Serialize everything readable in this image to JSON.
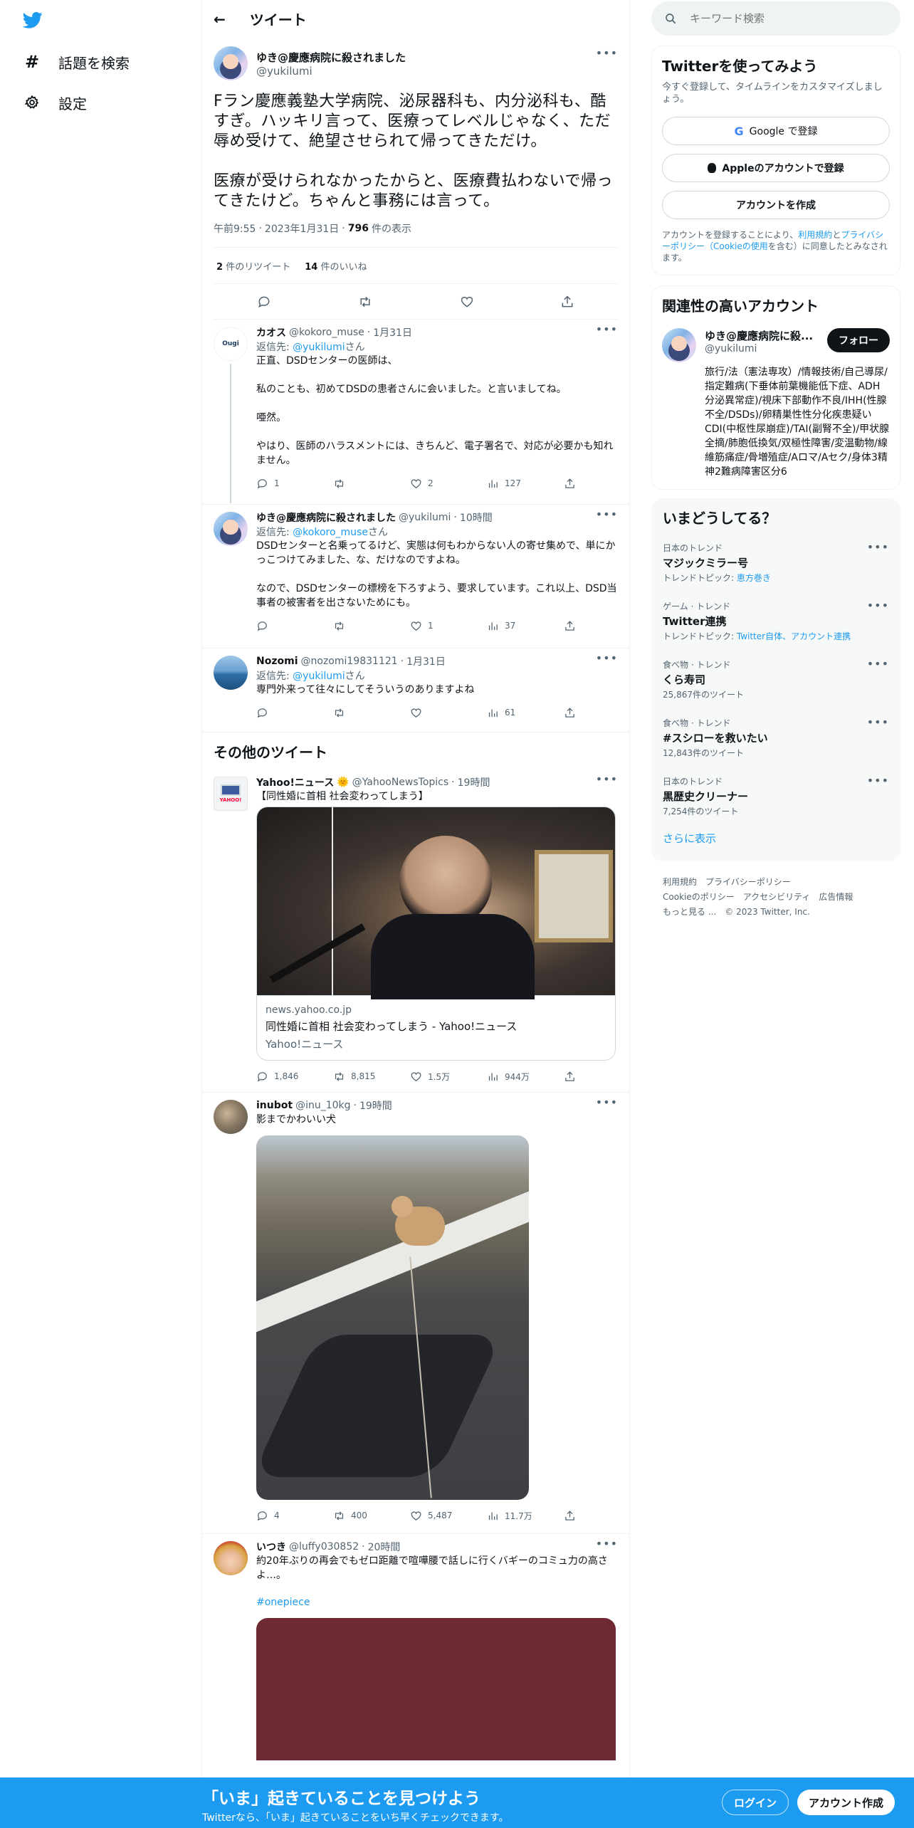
{
  "nav": {
    "explore": "話題を検索",
    "settings": "設定"
  },
  "header": {
    "title": "ツイート"
  },
  "tweet": {
    "author_name": "ゆき@慶應病院に殺されました",
    "author_handle": "@yukilumi",
    "text": "Fラン慶應義塾大学病院、泌尿器科も、内分泌科も、酷すぎ。ハッキリ言って、医療ってレベルじゃなく、ただ辱め受けて、絶望させられて帰ってきただけ。\n\n医療が受けられなかったからと、医療費払わないで帰ってきたけど。ちゃんと事務には言って。",
    "time": "午前9:55",
    "date": "2023年1月31日",
    "views": "796",
    "views_label": "件の表示",
    "retweets": "2",
    "retweets_label": "件のリツイート",
    "likes": "14",
    "likes_label": "件のいいね"
  },
  "replies": [
    {
      "name": "カオス",
      "handle": "@kokoro_muse",
      "time": "1月31日",
      "reply_to_prefix": "返信先: ",
      "reply_to": "@yukilumi",
      "reply_to_suffix": "さん",
      "text": "正直、DSDセンターの医師は、\n\n私のことも、初めてDSDの患者さんに会いました。と言いましてね。\n\n唖然。\n\nやはり、医師のハラスメントには、きちんど、電子署名で、対応が必要かも知れません。",
      "replies": "1",
      "retweets": "",
      "likes": "2",
      "views": "127",
      "avatar_text": "Ougi"
    },
    {
      "name": "ゆき@慶應病院に殺されました",
      "handle": "@yukilumi",
      "time": "10時間",
      "reply_to_prefix": "返信先: ",
      "reply_to": "@kokoro_muse",
      "reply_to_suffix": "さん",
      "text": "DSDセンターと名乗ってるけど、実態は何もわからない人の寄せ集めで、単にかっこつけてみました、な、だけなのですよね。\n\nなので、DSDセンターの標榜を下ろすよう、要求しています。これ以上、DSD当事者の被害者を出さないためにも。",
      "replies": "",
      "retweets": "",
      "likes": "1",
      "views": "37"
    },
    {
      "name": "Nozomi",
      "handle": "@nozomi19831121",
      "time": "1月31日",
      "reply_to_prefix": "返信先: ",
      "reply_to": "@yukilumi",
      "reply_to_suffix": "さん",
      "text": "専門外来って往々にしてそういうのありますよね",
      "replies": "",
      "retweets": "",
      "likes": "",
      "views": "61"
    }
  ],
  "more_tweets_title": "その他のツイート",
  "more": [
    {
      "name": "Yahoo!ニュース",
      "badge": "🌞",
      "handle": "@YahooNewsTopics",
      "time": "19時間",
      "text": "【同性婚に首相 社会変わってしまう】",
      "card_domain": "news.yahoo.co.jp",
      "card_title": "同性婚に首相 社会変わってしまう - Yahoo!ニュース",
      "card_source": "Yahoo!ニュース",
      "replies": "1,846",
      "retweets": "8,815",
      "likes": "1.5万",
      "views": "944万",
      "avatar_text": "YAHOO!"
    },
    {
      "name": "inubot",
      "handle": "@inu_10kg",
      "time": "19時間",
      "text": "影までかわいい犬",
      "replies": "4",
      "retweets": "400",
      "likes": "5,487",
      "views": "11.7万"
    },
    {
      "name": "いつき",
      "handle": "@luffy030852",
      "time": "20時間",
      "text": "約20年ぶりの再会でもゼロ距離で喧嘩腰で話しに行くバギーのコミュ力の高さよ…。",
      "hashtag": "#onepiece"
    }
  ],
  "search": {
    "placeholder": "キーワード検索"
  },
  "signup": {
    "title": "Twitterを使ってみよう",
    "subtitle": "今すぐ登録して、タイムラインをカスタマイズしましょう。",
    "google": "Google で登録",
    "apple": "Appleのアカウントで登録",
    "create": "アカウントを作成",
    "legal_1": "アカウントを登録することにより、",
    "legal_terms": "利用規約",
    "legal_2": "と",
    "legal_privacy": "プライバシーポリシー（Cookieの使用",
    "legal_3": "を含む）に同意したとみなされます。"
  },
  "related": {
    "title": "関連性の高いアカウント",
    "name": "ゆき@慶應病院に殺...",
    "handle": "@yukilumi",
    "follow": "フォロー",
    "bio": "旅行/法（憲法専攻）/情報技術/自己導尿/指定難病(下垂体前葉機能低下症、ADH分泌異常症)/視床下部動作不良/IHH(性腺不全/DSDs)/卵精巣性性分化疾患疑いCDI(中枢性尿崩症)/TAI(副腎不全)/甲状腺全摘/肺胞低換気/双極性障害/変温動物/線維筋痛症/骨増殖症/Aロマ/Aセク/身体3精神2難病障害区分6"
  },
  "trends": {
    "title": "いまどうしてる？",
    "items": [
      {
        "context": "日本のトレンド",
        "name": "マジックミラー号",
        "extra_prefix": "トレンドトピック: ",
        "extra_link": "恵方巻き"
      },
      {
        "context": "ゲーム · トレンド",
        "name": "Twitter連携",
        "extra_prefix": "トレンドトピック: ",
        "extra_link": "Twitter自体、アカウント連携"
      },
      {
        "context": "食べ物 · トレンド",
        "name": "くら寿司",
        "extra": "25,867件のツイート"
      },
      {
        "context": "食べ物 · トレンド",
        "name": "#スシローを救いたい",
        "extra": "12,843件のツイート"
      },
      {
        "context": "日本のトレンド",
        "name": "黒歴史クリーナー",
        "extra": "7,254件のツイート"
      }
    ],
    "more": "さらに表示"
  },
  "footer": {
    "terms": "利用規約",
    "privacy": "プライバシーポリシー",
    "cookie": "Cookieのポリシー",
    "accessibility": "アクセシビリティ",
    "ads": "広告情報",
    "more": "もっと見る ...",
    "copyright": "© 2023 Twitter, Inc."
  },
  "bottombar": {
    "title": "「いま」起きていることを見つけよう",
    "subtitle": "Twitterなら、「いま」起きていることをいち早くチェックできます。",
    "login": "ログイン",
    "signup": "アカウント作成"
  },
  "colors": {
    "accent": "#1d9bf0",
    "text": "#0f1419",
    "muted": "#536471"
  }
}
